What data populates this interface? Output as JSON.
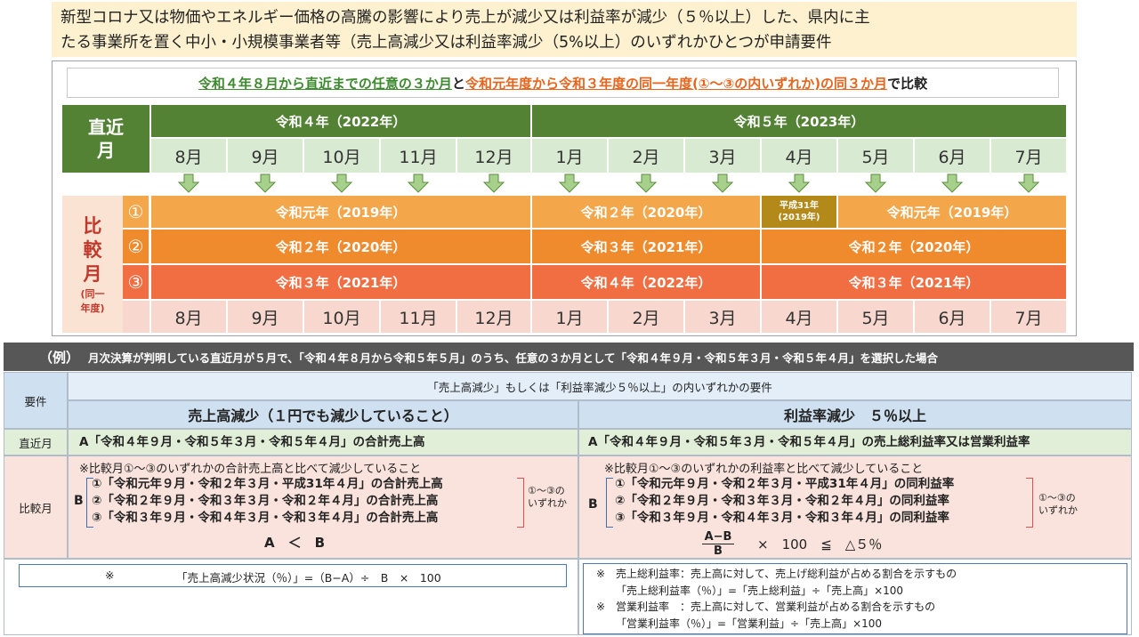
{
  "intro": {
    "line1": "新型コロナ又は物価やエネルギー価格の高騰の影響により売上が減少又は利益率が減少（５％以上）した、県内に主",
    "line2": "たる事業所を置く中小・小規模事業者等（売上高減少又は利益率減少（5%以上）のいずれかひとつが申請要件"
  },
  "compare": {
    "part1": "令和４年８月から直近までの任意の３か月",
    "part2": "と",
    "part3": "令和元年度から令和３年度の同一年度(①～③の内いずれか)の同３か月",
    "part4": "で比較"
  },
  "timeline": {
    "recent_label1": "直近",
    "recent_label2": "月",
    "year_2022": "令和４年（2022年）",
    "year_2023": "令和５年（2023年）",
    "months": [
      "8月",
      "9月",
      "10月",
      "11月",
      "12月",
      "1月",
      "2月",
      "3月",
      "4月",
      "5月",
      "6月",
      "7月"
    ],
    "compare_label": [
      "比",
      "較",
      "月"
    ],
    "compare_sub1": "(同一",
    "compare_sub2": "年度)",
    "circles": [
      "①",
      "②",
      "③"
    ],
    "row1": {
      "a": "令和元年（2019年）",
      "b": "令和２年（2020年）",
      "c1": "平成31年",
      "c2": "(2019年)",
      "d": "令和元年（2019年）"
    },
    "row2": {
      "a": "令和２年（2020年）",
      "b": "令和３年（2021年）",
      "c": "令和２年（2020年）"
    },
    "row3": {
      "a": "令和３年（2021年）",
      "b": "令和４年（2022年）",
      "c": "令和３年（2021年）"
    },
    "bottom_months": [
      "8月",
      "9月",
      "10月",
      "11月",
      "12月",
      "1月",
      "2月",
      "3月",
      "4月",
      "5月",
      "6月",
      "7月"
    ]
  },
  "example": {
    "label": "（例）",
    "text": "月次決算が判明している直近月が５月で、「令和４年８月から令和５年５月」のうち、任意の３か月として「令和４年９月・令和５年３月・令和５年４月」を選択した場合",
    "req_label": "要件",
    "req_header": "「売上高減少」もしくは「利益率減少５％以上」の内いずれかの要件",
    "left_header": "売上高減少（１円でも減少していること）",
    "right_header": "利益率減少　５％以上",
    "recent_label": "直近月",
    "compare_label": "比較月",
    "left_recent": "A「令和４年９月・令和５年３月・令和５年４月」の合計売上高",
    "right_recent": "A「令和４年９月・令和５年３月・令和５年４月」の売上総利益率又は営業利益率",
    "left_note": "※比較月①～③のいずれかの合計売上高と比べて減少していること",
    "left_items": [
      "①「令和元年９月・令和２年３月・平成31年４月」の合計売上高",
      "②「令和２年９月・令和３年３月・令和２年４月」の合計売上高",
      "③「令和３年９月・令和４年３月・令和３年４月」の合計売上高"
    ],
    "left_b": "B",
    "left_side1": "①～③の",
    "left_side2": "いずれか",
    "left_formula": "A　＜　B",
    "right_note": "※比較月①～③のいずれかの利益率と比べて減少していること",
    "right_items": [
      "①「令和元年９月・令和２年３月・平成31年４月」の同利益率",
      "②「令和２年９月・令和３年３月・令和２年４月」の同利益率",
      "③「令和３年９月・令和４年３月・令和３年４月」の同利益率"
    ],
    "right_b": "B",
    "right_side1": "①～③の",
    "right_side2": "いずれか",
    "right_frac_top": "A−B",
    "right_frac_bottom": "B",
    "right_formula_rest": "×　100　≦　△５％",
    "left_footer_mark": "※",
    "left_footer": "「売上高減少状況（％）」=（B−A）÷　B　×　100",
    "right_footer": [
      "※　売上総利益率：売上高に対して、売上げ総利益が占める割合を示すもの",
      "「売上総利益率（％）」=「売上総利益」÷「売上高」×100",
      "※　営業利益率　：売上高に対して、営業利益が占める割合を示すもの",
      "「営業利益率（％）」=「営業利益」÷「売上高」×100"
    ]
  },
  "colors": {
    "green_dark": "#548235",
    "green_light": "#d9ead3",
    "orange1": "#f4a64b",
    "orange2": "#ef8a2d",
    "orange3": "#f16e42",
    "gold": "#b38a1a",
    "pink": "#f8d8ce",
    "blue_header": "#cfe0f1",
    "blue_light": "#e3eef8",
    "green_row": "#e2efd8",
    "pink_row": "#f9e3dc"
  }
}
